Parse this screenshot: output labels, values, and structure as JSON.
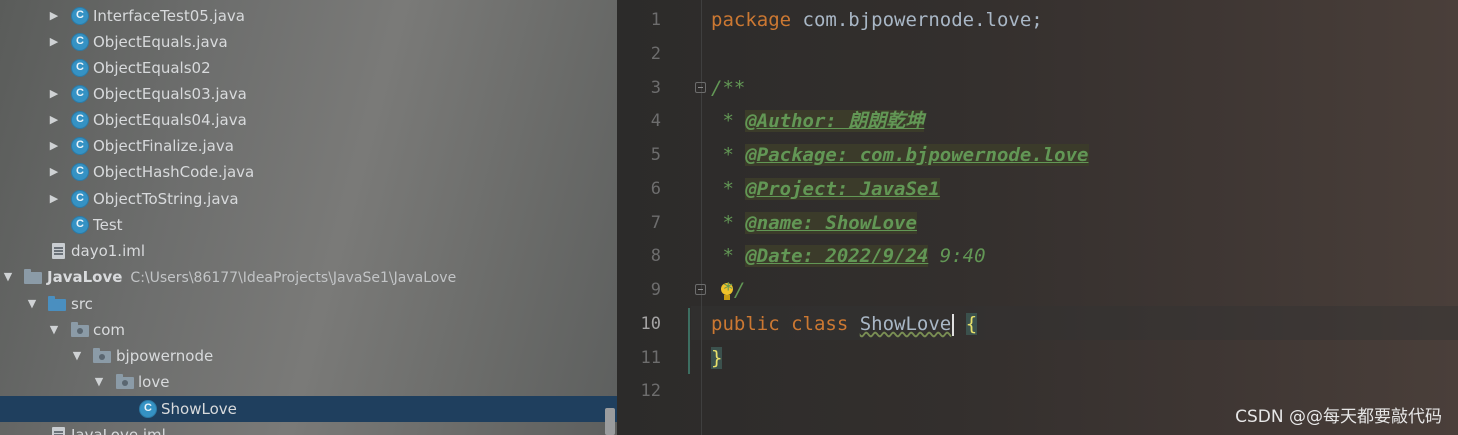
{
  "project_tree": {
    "items": [
      {
        "label": "InterfaceTest05.java",
        "type": "class",
        "expandable": true
      },
      {
        "label": "ObjectEquals.java",
        "type": "class",
        "expandable": true
      },
      {
        "label": "ObjectEquals02",
        "type": "class",
        "expandable": false
      },
      {
        "label": "ObjectEquals03.java",
        "type": "class",
        "expandable": true
      },
      {
        "label": "ObjectEquals04.java",
        "type": "class",
        "expandable": true
      },
      {
        "label": "ObjectFinalize.java",
        "type": "class",
        "expandable": true
      },
      {
        "label": "ObjectHashCode.java",
        "type": "class",
        "expandable": true
      },
      {
        "label": "ObjectToString.java",
        "type": "class",
        "expandable": true
      },
      {
        "label": "Test",
        "type": "class",
        "expandable": false
      },
      {
        "label": "dayo1.iml",
        "type": "file",
        "expandable": false
      },
      {
        "label": "JavaLove",
        "path": "C:\\Users\\86177\\IdeaProjects\\JavaSe1\\JavaLove",
        "type": "module",
        "expandable": true
      },
      {
        "label": "src",
        "type": "source-folder",
        "expandable": true
      },
      {
        "label": "com",
        "type": "package",
        "expandable": true
      },
      {
        "label": "bjpowernode",
        "type": "package",
        "expandable": true
      },
      {
        "label": "love",
        "type": "package",
        "expandable": true
      },
      {
        "label": "ShowLove",
        "type": "class",
        "expandable": false,
        "selected": true
      },
      {
        "label": "JavaLove.iml",
        "type": "file",
        "expandable": false
      }
    ]
  },
  "editor": {
    "active_line": 10,
    "line_numbers": [
      "1",
      "2",
      "3",
      "4",
      "5",
      "6",
      "7",
      "8",
      "9",
      "10",
      "11",
      "12"
    ],
    "code": {
      "l1_kw": "package",
      "l1_rest": " com.bjpowernode.love;",
      "l3": "/**",
      "l4_star": " * ",
      "l4_tag": "@Author: 朗朗乾坤",
      "l5_star": " * ",
      "l5_tag": "@Package: com.bjpowernode.love",
      "l6_star": " * ",
      "l6_tag": "@Project: JavaSe1",
      "l7_star": " * ",
      "l7_tag": "@name: ShowLove",
      "l8_star": " * ",
      "l8_tag": "@Date: 2022/9/24",
      "l8_rest": " 9:40",
      "l9": " */",
      "l10_kw": "public class",
      "l10_name": "ShowLove",
      "l10_brace": "{",
      "l11_brace": "}"
    }
  },
  "watermark": "CSDN @@每天都要敲代码",
  "icons": {
    "class": "class-icon",
    "package": "package-folder-icon",
    "file": "iml-file-icon",
    "hint": "lightbulb-icon"
  },
  "colors": {
    "keyword": "#cc7832",
    "comment": "#629755",
    "selection": "#1f3f5e"
  }
}
